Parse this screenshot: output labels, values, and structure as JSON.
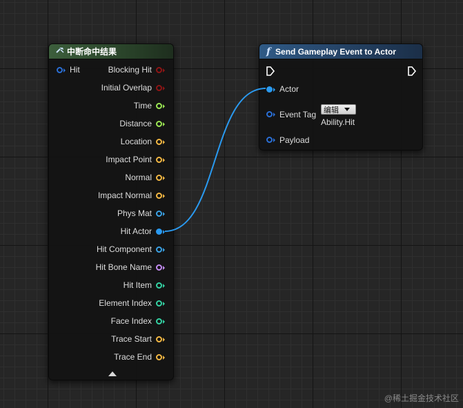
{
  "break_hit_node": {
    "title": "中断命中结果",
    "input_pin": "Hit",
    "output_pins": [
      {
        "label": "Blocking Hit",
        "color": "#8f1515",
        "type": "bool"
      },
      {
        "label": "Initial Overlap",
        "color": "#8f1515",
        "type": "bool"
      },
      {
        "label": "Time",
        "color": "#9be653",
        "type": "float"
      },
      {
        "label": "Distance",
        "color": "#9be653",
        "type": "float"
      },
      {
        "label": "Location",
        "color": "#f4b843",
        "type": "vector"
      },
      {
        "label": "Impact Point",
        "color": "#f4b843",
        "type": "vector"
      },
      {
        "label": "Normal",
        "color": "#f4b843",
        "type": "vector"
      },
      {
        "label": "Impact Normal",
        "color": "#f4b843",
        "type": "vector"
      },
      {
        "label": "Phys Mat",
        "color": "#3aa2e6",
        "type": "object"
      },
      {
        "label": "Hit Actor",
        "color": "#2a9af0",
        "type": "object",
        "connected": true
      },
      {
        "label": "Hit Component",
        "color": "#3aa2e6",
        "type": "object"
      },
      {
        "label": "Hit Bone Name",
        "color": "#c48cf2",
        "type": "name"
      },
      {
        "label": "Hit Item",
        "color": "#34d3a4",
        "type": "int"
      },
      {
        "label": "Element Index",
        "color": "#34d3a4",
        "type": "int"
      },
      {
        "label": "Face Index",
        "color": "#34d3a4",
        "type": "int"
      },
      {
        "label": "Trace Start",
        "color": "#f4b843",
        "type": "vector"
      },
      {
        "label": "Trace End",
        "color": "#f4b843",
        "type": "vector"
      }
    ],
    "header_icon": "break-struct-icon",
    "collapse_icon": "collapse-arrow-icon"
  },
  "send_event_node": {
    "title": "Send Gameplay Event to Actor",
    "function_icon": "function-icon",
    "pins": {
      "actor": "Actor",
      "event_tag": "Event Tag",
      "payload": "Payload"
    },
    "event_tag_dropdown": "编辑",
    "event_tag_value": "Ability.Hit"
  },
  "colors": {
    "struct_header": "#2f4f2f",
    "function_header": "#28476b",
    "wire": "#2a9af0",
    "object_pin": "#2a9af0",
    "struct_pin": "#2a6fd6"
  },
  "watermark": "@稀土掘金技术社区"
}
